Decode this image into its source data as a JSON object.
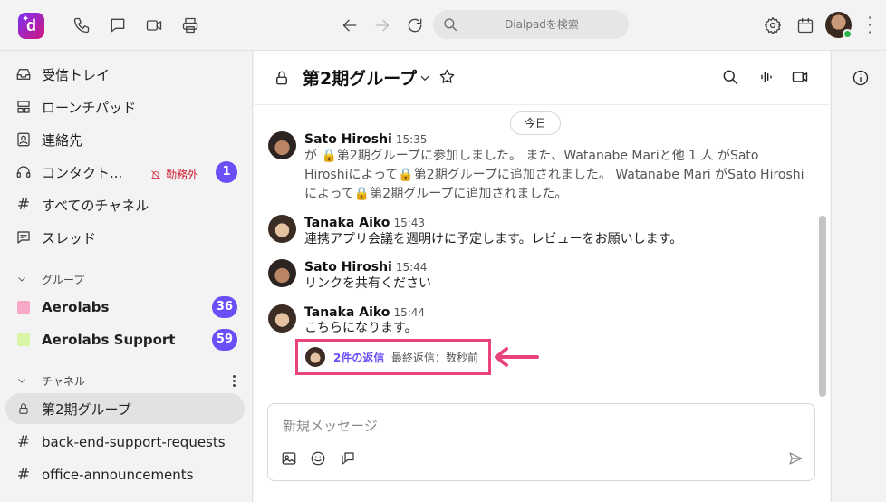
{
  "topbar": {
    "logo_letter": "d",
    "search_placeholder": "Dialpadを検索"
  },
  "sidebar": {
    "items": [
      {
        "label": "受信トレイ",
        "icon": "inbox-icon"
      },
      {
        "label": "ローンチパッド",
        "icon": "launchpad-icon"
      },
      {
        "label": "連絡先",
        "icon": "contacts-icon"
      },
      {
        "label": "コンタクト...",
        "icon": "headset-icon",
        "status": "勤務外",
        "badge": "1"
      },
      {
        "label": "すべてのチャネル",
        "icon": "hash-icon"
      },
      {
        "label": "スレッド",
        "icon": "threads-icon"
      }
    ],
    "groups_header": "グループ",
    "groups": [
      {
        "label": "Aerolabs",
        "color": "#f7a8c7",
        "badge": "36"
      },
      {
        "label": "Aerolabs Support",
        "color": "#d9f5a6",
        "badge": "59"
      }
    ],
    "channels_header": "チャネル",
    "channels": [
      {
        "label": "第2期グループ",
        "icon": "lock-icon",
        "active": true
      },
      {
        "label": "back-end-support-requests",
        "icon": "hash-icon"
      },
      {
        "label": "office-announcements",
        "icon": "hash-icon"
      }
    ]
  },
  "channel": {
    "title": "第2期グループ",
    "date_divider": "今日"
  },
  "messages": [
    {
      "author": "Sato Hiroshi",
      "time": "15:35",
      "body": "が 🔒第2期グループに参加しました。 また、Watanabe Mariと他 1 人 がSato Hiroshiによって🔒第2期グループに追加されました。 Watanabe Mari がSato Hiroshiによって🔒第2期グループに追加されました。"
    },
    {
      "author": "Tanaka Aiko",
      "time": "15:43",
      "body": "連携アプリ会議を週明けに予定します。レビューをお願いします。"
    },
    {
      "author": "Sato Hiroshi",
      "time": "15:44",
      "body": "リンクを共有ください"
    },
    {
      "author": "Tanaka Aiko",
      "time": "15:44",
      "body": "こちらになります。"
    }
  ],
  "thread": {
    "reply_count": "2件の返信",
    "last_reply": "最終返信：数秒前"
  },
  "composer": {
    "placeholder": "新規メッセージ"
  },
  "colors": {
    "accent": "#6b4ef6",
    "highlight": "#e8437c",
    "dnd": "#d0192d"
  }
}
